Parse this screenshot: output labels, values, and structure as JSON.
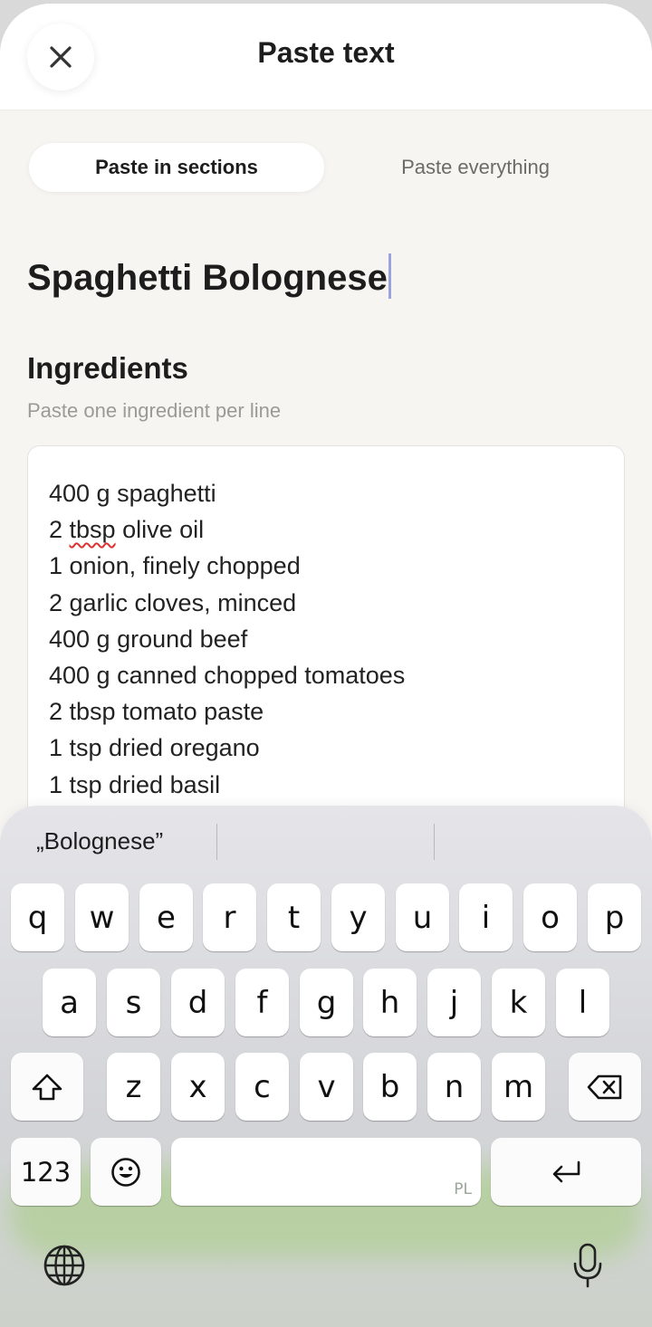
{
  "header": {
    "title": "Paste text"
  },
  "tabs": {
    "sections": "Paste in sections",
    "everything": "Paste everything"
  },
  "recipe": {
    "title": "Spaghetti Bolognese"
  },
  "ingredients": {
    "title": "Ingredients",
    "hint": "Paste one ingredient per line",
    "lines": [
      "400 g spaghetti",
      "2 tbsp olive oil",
      "1 onion, finely chopped",
      "2 garlic cloves, minced",
      "400 g ground beef",
      "400 g canned chopped tomatoes",
      "2 tbsp tomato paste",
      "1 tsp dried oregano",
      "1 tsp dried basil"
    ]
  },
  "keyboard": {
    "suggestion": "„Bolognese”",
    "row1": [
      "q",
      "w",
      "e",
      "r",
      "t",
      "y",
      "u",
      "i",
      "o",
      "p"
    ],
    "row2": [
      "a",
      "s",
      "d",
      "f",
      "g",
      "h",
      "j",
      "k",
      "l"
    ],
    "row3": [
      "z",
      "x",
      "c",
      "v",
      "b",
      "n",
      "m"
    ],
    "numbers_label": "123",
    "space_language": "PL",
    "shift_icon": "shift-arrow-icon",
    "delete_icon": "backspace-icon",
    "emoji_icon": "emoji-icon",
    "return_icon": "return-icon",
    "globe_icon": "globe-icon",
    "mic_icon": "microphone-icon"
  },
  "colors": {
    "accent_caret": "#9aa3de",
    "spellcheck": "#e0312f",
    "background": "#f6f5f1"
  }
}
